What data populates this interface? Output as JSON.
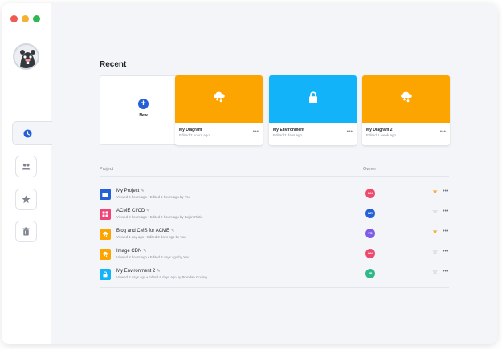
{
  "section_title": "Recent",
  "new_card": {
    "label": "New",
    "icon": "plus-icon"
  },
  "recent_cards": [
    {
      "name": "My Diagram",
      "sub": "Edited 2 hours ago",
      "color": "#fca400",
      "icon": "cloud-icon"
    },
    {
      "name": "My Environment",
      "sub": "Edited 2 days ago",
      "color": "#13b3fa",
      "icon": "lock-icon"
    },
    {
      "name": "My Diagram 2",
      "sub": "Edited 1 week ago",
      "color": "#fca400",
      "icon": "cloud-icon"
    }
  ],
  "card_menu_label": "•••",
  "table": {
    "col_project": "Project",
    "col_owner": "Owner",
    "rows": [
      {
        "name": "My Project",
        "meta": "Viewed 6 hours ago • Edited 6 hours ago by You",
        "icon_color": "#2560d8",
        "icon": "folder-icon",
        "owner": "DN",
        "owner_color": "#ee4a6b",
        "starred": true
      },
      {
        "name": "ACME CI/CD",
        "meta": "Viewed 9 hours ago • Edited 9 hours ago by Bojan Ristic",
        "icon_color": "#f04477",
        "icon": "grid-icon",
        "owner": "BR",
        "owner_color": "#2560d8",
        "starred": false
      },
      {
        "name": "Blog and CMS for ACME",
        "meta": "Viewed 1 day ago • Edited 2 days ago by You",
        "icon_color": "#fca400",
        "icon": "cloud-icon",
        "owner": "FS",
        "owner_color": "#7e5ce6",
        "starred": true
      },
      {
        "name": "Image CDN",
        "meta": "Viewed 8 hours ago • Edited 3 days ago by You",
        "icon_color": "#fca400",
        "icon": "cloud-icon",
        "owner": "DN",
        "owner_color": "#ee4a6b",
        "starred": false
      },
      {
        "name": "My Environment 2",
        "meta": "Viewed 2 days ago • Edited 6 days ago by Brendan Gouing",
        "icon_color": "#13b3fa",
        "icon": "lock-icon",
        "owner": "JB",
        "owner_color": "#2fb88a",
        "starred": false
      }
    ]
  },
  "star_filled_color": "#f5a623",
  "star_empty_color": "#9aa0aa",
  "row_menu_label": "•••"
}
